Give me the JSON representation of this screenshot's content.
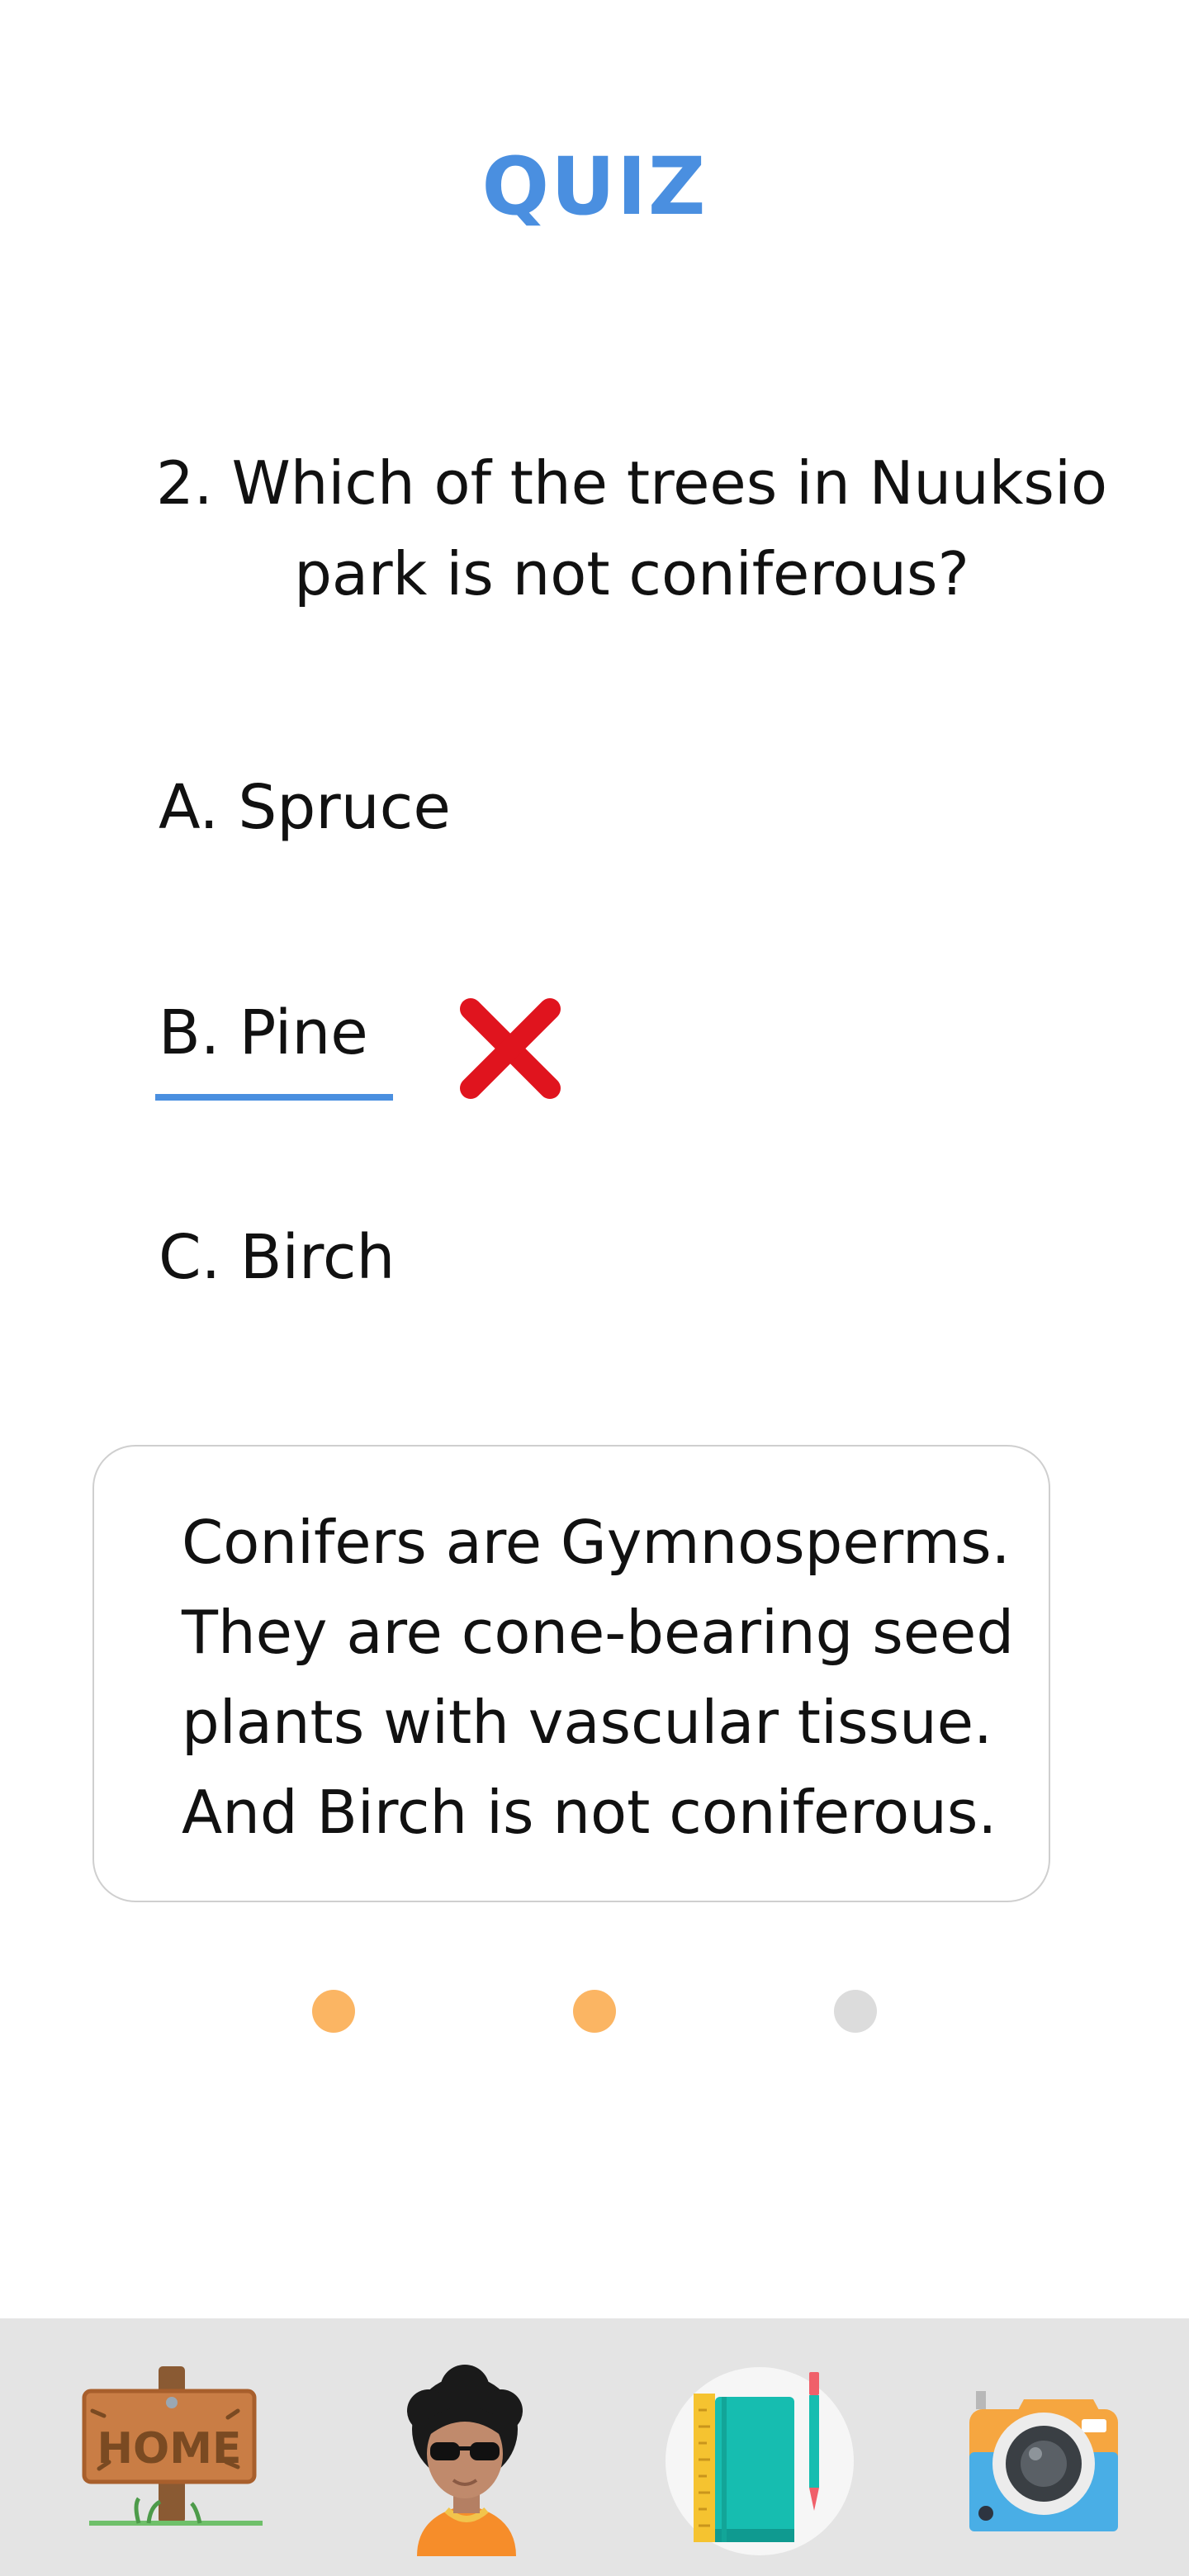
{
  "header": {
    "title": "QUIZ"
  },
  "question": {
    "text": "2. Which of the trees in Nuuksio park is not coniferous?"
  },
  "options": [
    {
      "label": "A. Spruce",
      "selected": false
    },
    {
      "label": "B. Pine",
      "selected": true,
      "result": "incorrect"
    },
    {
      "label": "C. Birch",
      "selected": false
    }
  ],
  "explanation": {
    "text": "Conifers are Gymnosperms. They are cone-bearing seed plants with vascular tissue. And Birch is not coniferous."
  },
  "pagination": {
    "total": 3,
    "completed": 2,
    "colors": {
      "done": "#fbb563",
      "pending": "#dcdcdc"
    }
  },
  "nav": {
    "items": [
      {
        "name": "home",
        "icon": "home-sign-icon",
        "sign_text": "HOME"
      },
      {
        "name": "profile",
        "icon": "avatar-icon"
      },
      {
        "name": "notebook",
        "icon": "notebook-icon",
        "active": true
      },
      {
        "name": "camera",
        "icon": "camera-icon"
      }
    ]
  },
  "colors": {
    "accent": "#4a8fe0",
    "wrong": "#e0141e",
    "nav_bg": "#e4e4e4"
  }
}
